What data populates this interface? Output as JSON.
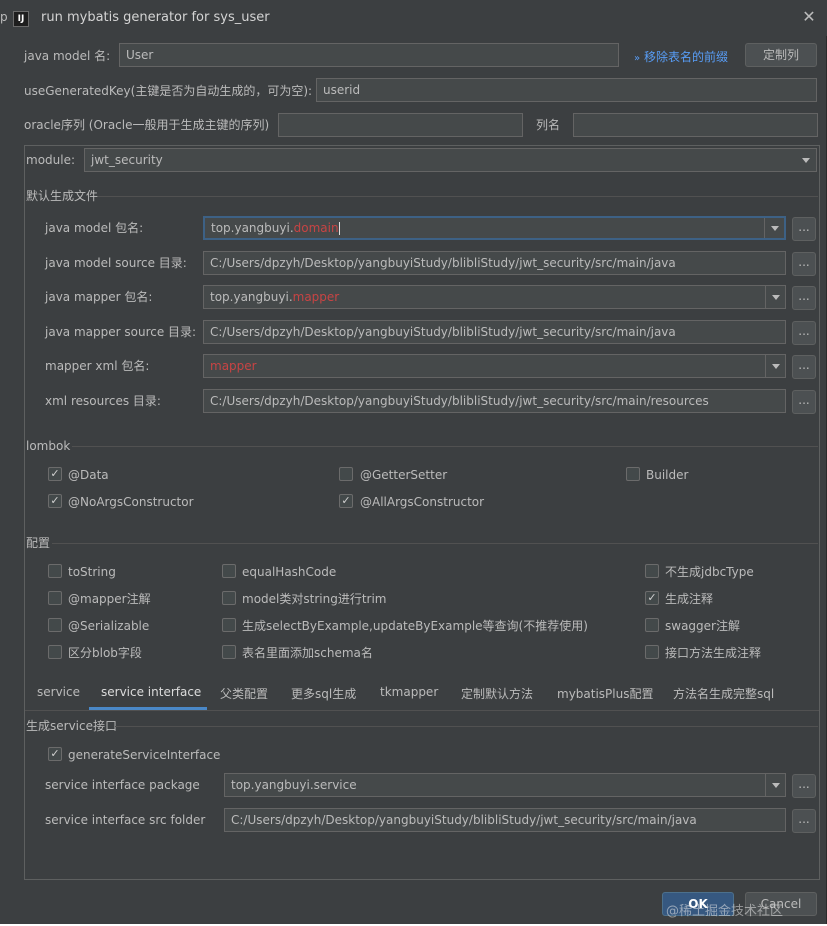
{
  "window": {
    "title": "run mybatis generator for sys_user",
    "app_icon": "IJ",
    "side_stub": "p"
  },
  "top": {
    "model_name_label": "java model 名:",
    "model_name_value": "User",
    "remove_prefix_link": "移除表名的前缀",
    "customize_columns_button": "定制列",
    "use_generated_key_label": "useGeneratedKey(主键是否为自动生成的，可为空):",
    "use_generated_key_value": "userid",
    "oracle_seq_label": "oracle序列 (Oracle一般用于生成主键的序列)",
    "oracle_seq_value": "",
    "column_name_label": "列名",
    "column_name_value": "",
    "module_label": "module:",
    "module_value": "jwt_security"
  },
  "default_files": {
    "section_title": "默认生成文件",
    "rows": [
      {
        "label": "java model 包名:",
        "prefix": "top.yangbuyi.",
        "suffix": "domain",
        "type": "combo"
      },
      {
        "label": "java model source 目录:",
        "prefix": "C:/Users/dpzyh/Desktop/yangbuyiStudy/blibliStudy/jwt_security/src/main/java",
        "suffix": "",
        "type": "text"
      },
      {
        "label": "java mapper 包名:",
        "prefix": "top.yangbuyi.",
        "suffix": "mapper",
        "type": "combo"
      },
      {
        "label": "java mapper source 目录:",
        "prefix": "C:/Users/dpzyh/Desktop/yangbuyiStudy/blibliStudy/jwt_security/src/main/java",
        "suffix": "",
        "type": "text"
      },
      {
        "label": "mapper xml 包名:",
        "prefix": "",
        "suffix": "mapper",
        "type": "combo"
      },
      {
        "label": "xml resources 目录:",
        "prefix": "C:/Users/dpzyh/Desktop/yangbuyiStudy/blibliStudy/jwt_security/src/main/resources",
        "suffix": "",
        "type": "text"
      }
    ],
    "browse_label": "..."
  },
  "lombok": {
    "section_title": "lombok",
    "items": [
      {
        "label": "@Data",
        "checked": "✓"
      },
      {
        "label": "@GetterSetter",
        "checked": ""
      },
      {
        "label": "Builder",
        "checked": ""
      },
      {
        "label": "@NoArgsConstructor",
        "checked": "✓"
      },
      {
        "label": "@AllArgsConstructor",
        "checked": "✓"
      }
    ]
  },
  "config": {
    "section_title": "配置",
    "items": [
      {
        "label": "toString",
        "checked": ""
      },
      {
        "label": "equalHashCode",
        "checked": ""
      },
      {
        "label": "不生成jdbcType",
        "checked": ""
      },
      {
        "label": "@mapper注解",
        "checked": ""
      },
      {
        "label": "model类对string进行trim",
        "checked": ""
      },
      {
        "label": "生成注释",
        "checked": "✓"
      },
      {
        "label": "@Serializable",
        "checked": ""
      },
      {
        "label": "生成selectByExample,updateByExample等查询(不推荐使用)",
        "checked": ""
      },
      {
        "label": "swagger注解",
        "checked": ""
      },
      {
        "label": "区分blob字段",
        "checked": ""
      },
      {
        "label": "表名里面添加schema名",
        "checked": ""
      },
      {
        "label": "接口方法生成注释",
        "checked": ""
      }
    ]
  },
  "tabs": [
    {
      "label": "service"
    },
    {
      "label": "service interface"
    },
    {
      "label": "父类配置"
    },
    {
      "label": "更多sql生成"
    },
    {
      "label": "tkmapper"
    },
    {
      "label": "定制默认方法"
    },
    {
      "label": "mybatisPlus配置"
    },
    {
      "label": "方法名生成完整sql"
    }
  ],
  "service_interface": {
    "section_title": "生成service接口",
    "generate_label": "generateServiceInterface",
    "generate_checked": "✓",
    "package_label": "service interface package",
    "package_value": "top.yangbuyi.service",
    "folder_label": "service interface src folder",
    "folder_value": "C:/Users/dpzyh/Desktop/yangbuyiStudy/blibliStudy/jwt_security/src/main/java"
  },
  "footer": {
    "ok_label": "OK",
    "cancel_label": "Cancel",
    "watermark": "@稀土掘金技术社区"
  },
  "colors": {
    "background": "#3c3f41",
    "input_bg": "#45494a",
    "accent": "#4a88c7",
    "highlight_text": "#c74444",
    "link": "#589df6"
  }
}
